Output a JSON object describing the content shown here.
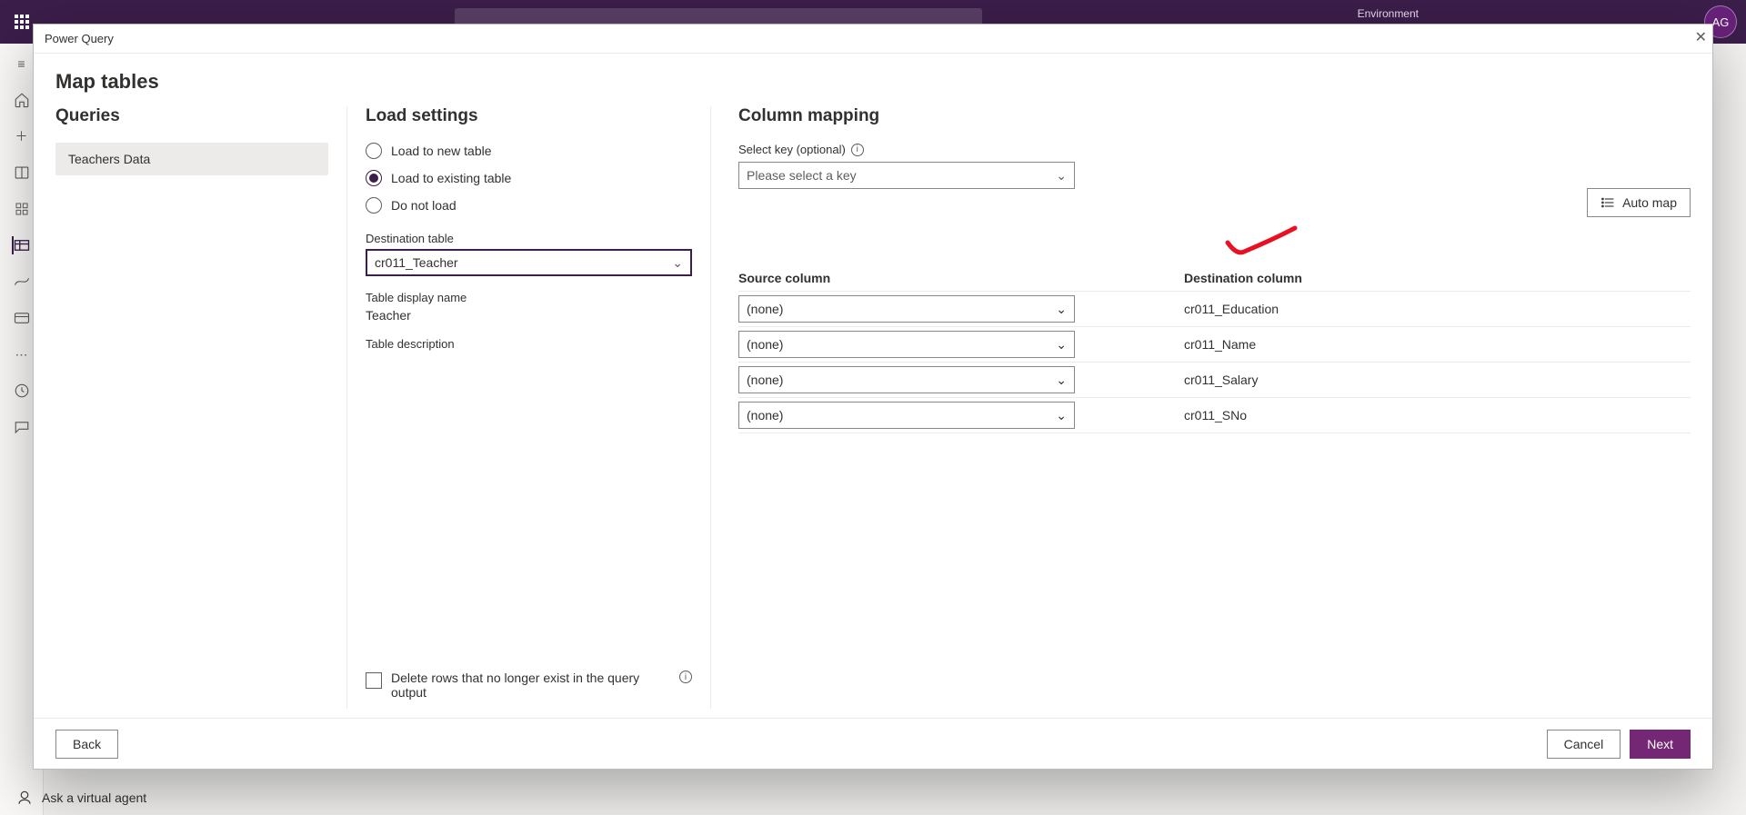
{
  "topbar": {
    "environment_label": "Environment",
    "avatar_initials": "AG"
  },
  "sidebar": {
    "ask_agent": "Ask a virtual agent"
  },
  "modal": {
    "header_title": "Power Query",
    "title": "Map tables",
    "queries": {
      "heading": "Queries",
      "items": [
        "Teachers Data"
      ]
    },
    "load_settings": {
      "heading": "Load settings",
      "options": {
        "new_table": "Load to new table",
        "existing_table": "Load to existing table",
        "do_not_load": "Do not load"
      },
      "dest_table_label": "Destination table",
      "dest_table_value": "cr011_Teacher",
      "display_name_label": "Table display name",
      "display_name_value": "Teacher",
      "description_label": "Table description",
      "delete_rows_label": "Delete rows that no longer exist in the query output"
    },
    "column_mapping": {
      "heading": "Column mapping",
      "key_label": "Select key (optional)",
      "key_placeholder": "Please select a key",
      "automap_label": "Auto map",
      "src_header": "Source column",
      "dst_header": "Destination column",
      "rows": [
        {
          "src": "(none)",
          "dst": "cr011_Education"
        },
        {
          "src": "(none)",
          "dst": "cr011_Name"
        },
        {
          "src": "(none)",
          "dst": "cr011_Salary"
        },
        {
          "src": "(none)",
          "dst": "cr011_SNo"
        }
      ]
    },
    "footer": {
      "back": "Back",
      "cancel": "Cancel",
      "next": "Next"
    }
  }
}
